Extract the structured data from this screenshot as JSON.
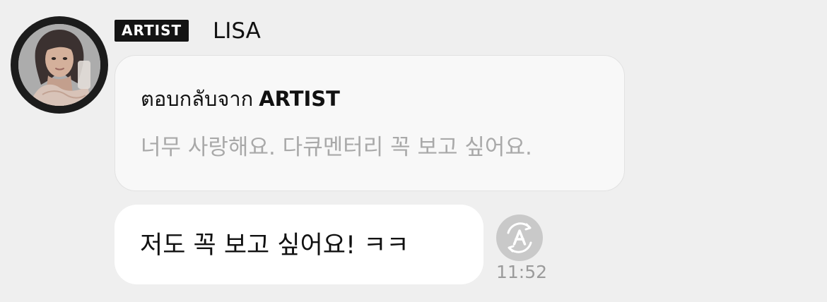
{
  "sender": {
    "badge": "ARTIST",
    "name": "LISA",
    "avatar_icon": "profile-photo"
  },
  "reply": {
    "prefix": "ตอบกลับจาก",
    "target": "ARTIST",
    "quoted_text": "너무 사랑해요. 다큐멘터리 꼭 보고 싶어요."
  },
  "message": {
    "text": "저도 꼭 보고 싶어요! ㅋㅋ",
    "time": "11:52",
    "translate_icon": "translate-icon"
  },
  "colors": {
    "background": "#efefef",
    "badge_background": "#141414",
    "reply_card_background": "#f8f8f8",
    "quoted_text": "#a9a9a9",
    "bubble_background": "#ffffff",
    "timestamp": "#9b9b9b"
  }
}
